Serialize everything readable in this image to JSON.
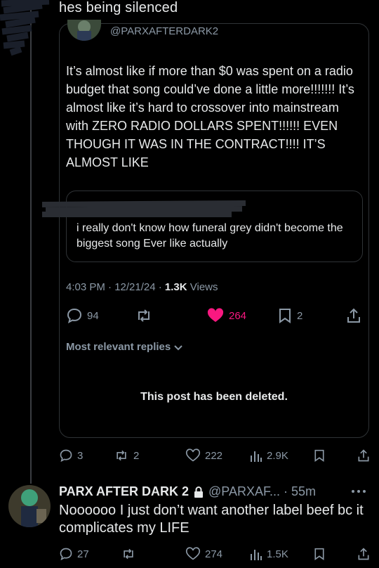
{
  "top_text": "hes being silenced",
  "quoted_post": {
    "handle": "@PARXAFTERDARK2",
    "text": "It’s almost like if more than $0 was spent on a radio budget that song could’ve done a little more!!!!!!! It’s almost like it’s hard to crossover into mainstream with ZERO RADIO DOLLARS SPENT!!!!!! EVEN THOUGH IT WAS IN THE CONTRACT!!!! IT’S ALMOST LIKE",
    "nested_quote_text": "i really don't know how funeral grey didn't become the biggest song Ever like actually",
    "time": "4:03 PM · 12/21/24 · ",
    "views_count": "1.3K",
    "views_label": " Views",
    "actions": {
      "replies": "94",
      "reposts": "",
      "likes": "264",
      "bookmarks": "2"
    },
    "relevant_label": "Most relevant replies",
    "deleted_label": "This post has been deleted."
  },
  "post_actions": {
    "replies": "3",
    "reposts": "2",
    "likes": "222",
    "views": "2.9K"
  },
  "reply": {
    "author_name": "PARX AFTER DARK 2",
    "handle_time": "@PARXAF... · 55m",
    "text": "Noooooo I just don’t want another label beef bc it complicates my LIFE",
    "actions": {
      "replies": "27",
      "reposts": "",
      "likes": "274",
      "views": "1.5K"
    }
  },
  "colors": {
    "like_active": "#f91880",
    "muted": "#8b98a5",
    "border": "#2f3336"
  }
}
